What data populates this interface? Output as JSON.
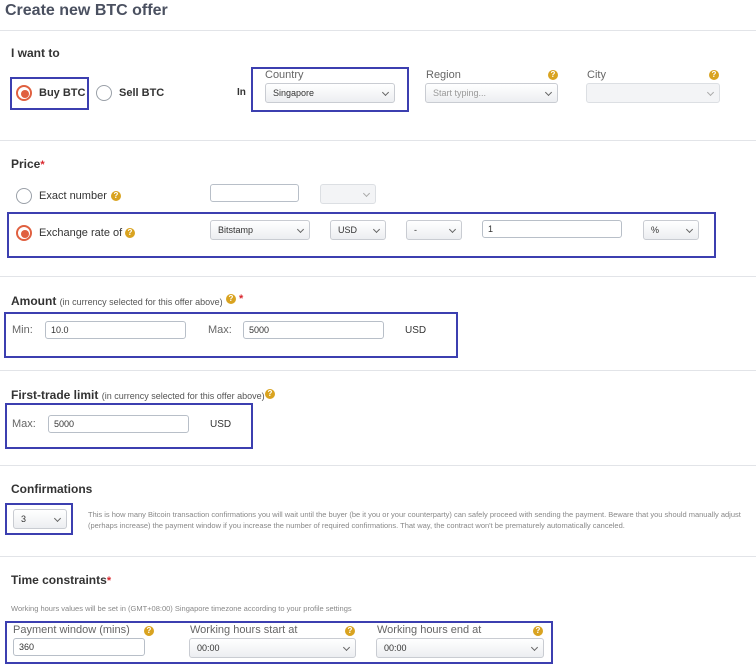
{
  "page": {
    "title": "Create new BTC offer"
  },
  "i_want_to": {
    "title": "I want to",
    "buy_label": "Buy BTC",
    "sell_label": "Sell BTC",
    "selected": "buy",
    "in_label": "In",
    "country_label": "Country",
    "country_value": "Singapore",
    "region_label": "Region",
    "region_placeholder": "Start typing...",
    "city_label": "City",
    "city_value": ""
  },
  "price": {
    "title": "Price",
    "required_mark": "*",
    "exact_label": "Exact number",
    "exact_value": "",
    "exact_currency": "",
    "exchange_label": "Exchange rate of",
    "selected": "exchange",
    "exchange_source": "Bitstamp",
    "currency": "USD",
    "operator": "-",
    "rate_value": "1",
    "unit": "%"
  },
  "amount": {
    "title": "Amount",
    "note": "(in currency selected for this offer above)",
    "required_mark": "*",
    "min_label": "Min:",
    "min_value": "10.0",
    "max_label": "Max:",
    "max_value": "5000",
    "currency": "USD"
  },
  "first_trade": {
    "title": "First-trade limit",
    "note": "(in currency selected for this offer above)",
    "max_label": "Max:",
    "max_value": "5000",
    "currency": "USD"
  },
  "confirmations": {
    "title": "Confirmations",
    "value": "3",
    "note": "This is how many Bitcoin transaction confirmations you will wait until the buyer (be it you or your counterparty) can safely proceed with sending the payment. Beware that you should manually adjust (perhaps increase) the payment window if you increase the number of required confirmations. That way, the contract won't be prematurely automatically canceled."
  },
  "time_constraints": {
    "title": "Time constraints",
    "required_mark": "*",
    "timezone_note": "Working hours values will be set in (GMT+08:00) Singapore timezone according to your profile settings",
    "payment_window_label": "Payment window (mins)",
    "payment_window_value": "360",
    "start_label": "Working hours start at",
    "start_value": "00:00",
    "end_label": "Working hours end at",
    "end_value": "00:00"
  },
  "icons": {
    "help": "help-icon",
    "dropdown": "chevron-down-icon"
  },
  "colors": {
    "highlight": "#3c3fb0",
    "radio_selected": "#e06040",
    "help": "#d9a320",
    "required": "#d9272e"
  }
}
